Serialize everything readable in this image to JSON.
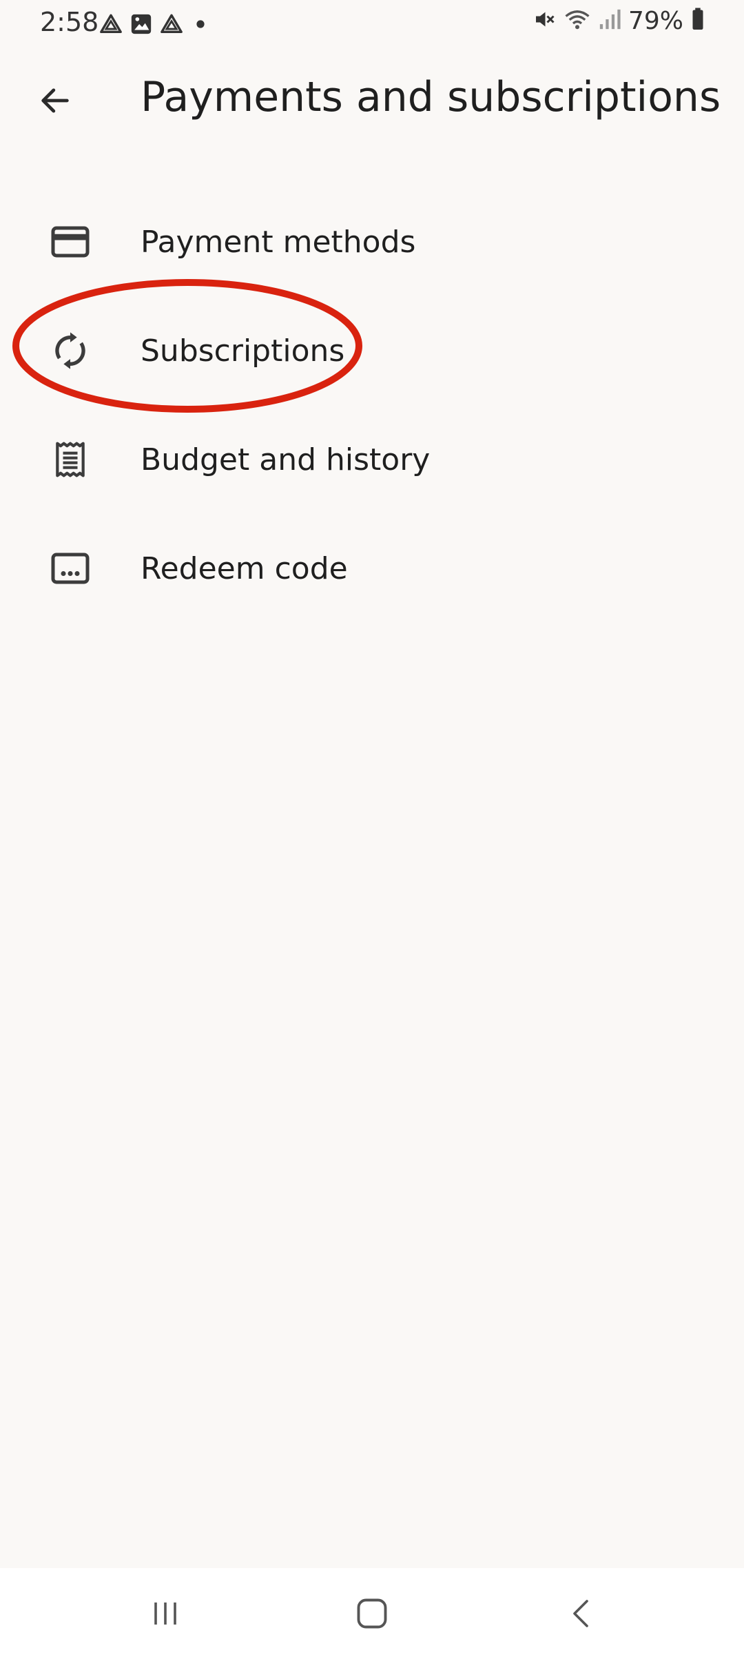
{
  "status_bar": {
    "time": "2:58",
    "left_icons": [
      "drive-icon",
      "image-icon",
      "drive-icon",
      "dot-icon"
    ],
    "right_icons": [
      "mute-icon",
      "wifi-icon",
      "signal-icon",
      "battery-icon"
    ],
    "battery_percent": "79%"
  },
  "header": {
    "title": "Payments and subscriptions",
    "back_icon": "arrow-left-icon"
  },
  "menu": {
    "items": [
      {
        "label": "Payment methods",
        "icon": "credit-card-icon"
      },
      {
        "label": "Subscriptions",
        "icon": "sync-icon"
      },
      {
        "label": "Budget and history",
        "icon": "receipt-icon"
      },
      {
        "label": "Redeem code",
        "icon": "redeem-code-icon"
      }
    ]
  },
  "annotation": {
    "color": "#d9230f",
    "target": "Subscriptions"
  },
  "nav_bar": {
    "buttons": [
      "recents-icon",
      "home-icon",
      "back-icon"
    ]
  },
  "colors": {
    "background": "#faf8f6",
    "text": "#1f1f1f",
    "icon": "#3c3c3c"
  }
}
